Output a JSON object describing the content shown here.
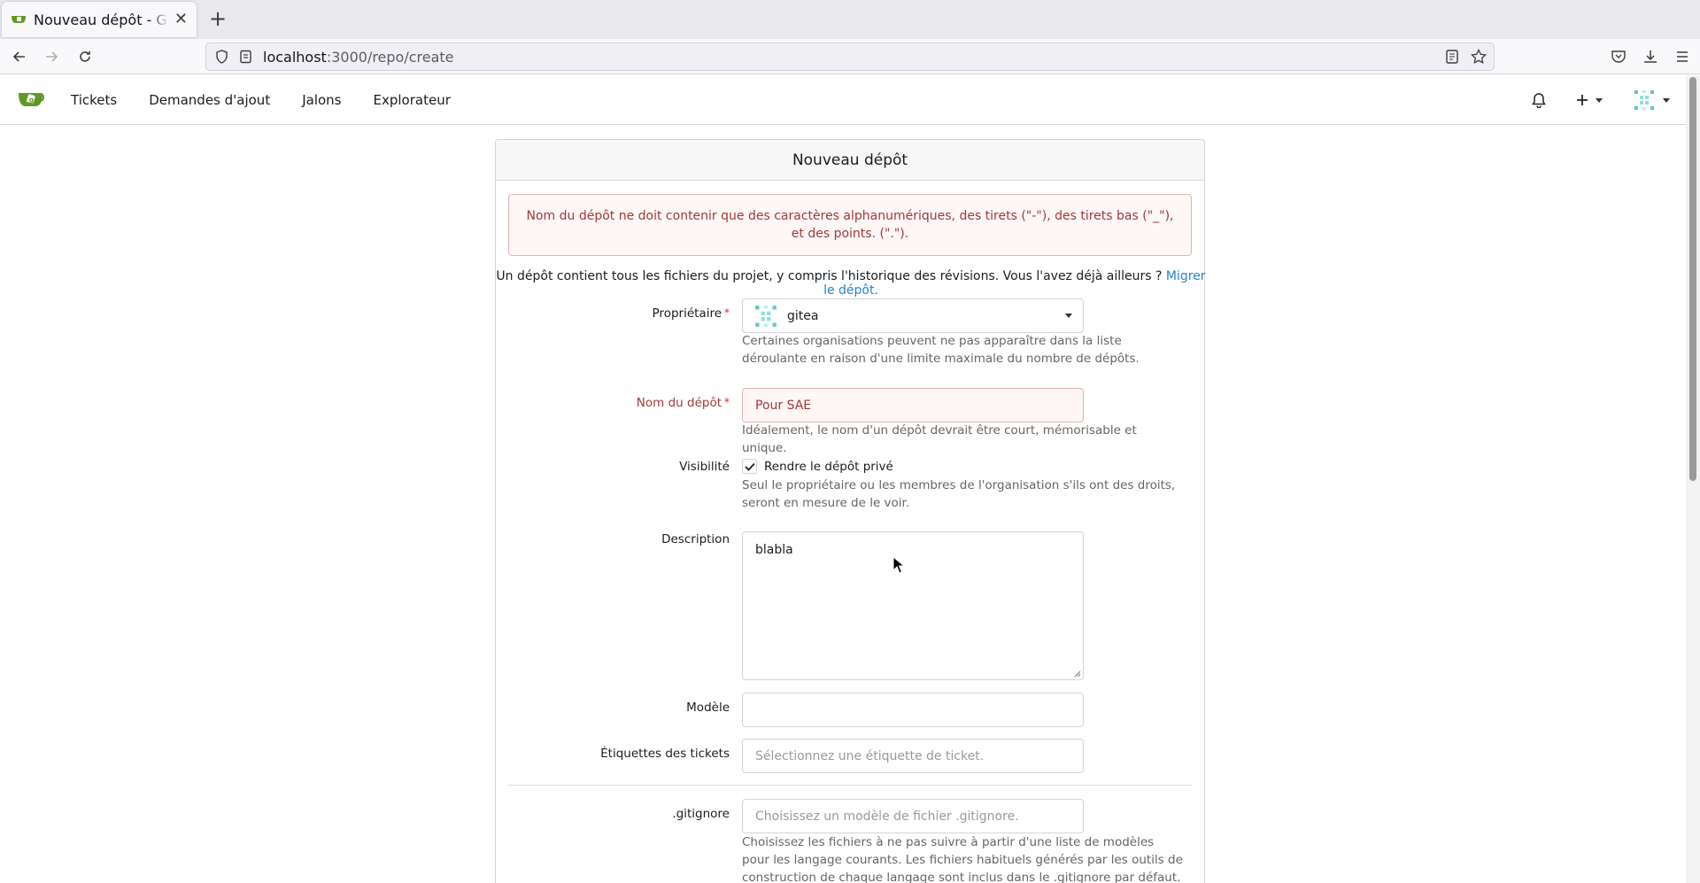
{
  "browser": {
    "tab_title": "Nouveau dépôt - Gitea: Git with a cup of tea",
    "url_host": "localhost",
    "url_path": ":3000/repo/create"
  },
  "header": {
    "nav": [
      "Tickets",
      "Demandes d'ajout",
      "Jalons",
      "Explorateur"
    ],
    "brand_color": "#609926"
  },
  "form": {
    "title": "Nouveau dépôt",
    "error_message": "Nom du dépôt ne doit contenir que des caractères alphanumériques, des tirets (\"-\"), des tirets bas (\"_\"), et des points. (\".\").",
    "intro_text": "Un dépôt contient tous les fichiers du projet, y compris l'historique des révisions. Vous l'avez déjà ailleurs ?",
    "intro_link": "Migrer le dépôt.",
    "owner": {
      "label": "Propriétaire",
      "value": "gitea",
      "help": "Certaines organisations peuvent ne pas apparaître dans la liste déroulante en raison d'une limite maximale du nombre de dépôts."
    },
    "repo_name": {
      "label": "Nom du dépôt",
      "value": "Pour SAE",
      "help": "Idéalement, le nom d'un dépôt devrait être court, mémorisable et unique."
    },
    "visibility": {
      "label": "Visibilité",
      "checkbox_label": "Rendre le dépôt privé",
      "checked": true,
      "help": "Seul le propriétaire ou les membres de l'organisation s'ils ont des droits, seront en mesure de le voir."
    },
    "description": {
      "label": "Description",
      "value": "blabla"
    },
    "template": {
      "label": "Modèle",
      "value": ""
    },
    "issue_labels": {
      "label": "Étiquettes des tickets",
      "placeholder": "Sélectionnez une étiquette de ticket."
    },
    "gitignore": {
      "label": ".gitignore",
      "placeholder": "Choisissez un modèle de fichier .gitignore.",
      "help": "Choisissez les fichiers à ne pas suivre à partir d'une liste de modèles pour les langage courants. Les fichiers habituels générés par les outils de construction de chaque langage sont inclus dans le .gitignore par défaut."
    }
  },
  "colors": {
    "error_bg": "#fff6f6",
    "error_text": "#9f3a38",
    "link": "#2185d0"
  }
}
